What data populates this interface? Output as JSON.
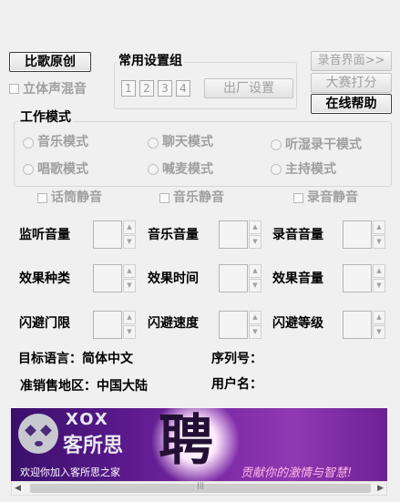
{
  "buttons": {
    "compare_original": "比歌原创",
    "recording_ui": "录音界面>>",
    "contest_score": "大赛打分",
    "online_help": "在线帮助",
    "factory_settings": "出厂设置"
  },
  "stereo_mix": "立体声混音",
  "preset_group": {
    "title": "常用设置组",
    "numbers": [
      "1",
      "2",
      "3",
      "4"
    ]
  },
  "work_mode": {
    "title": "工作模式",
    "options": [
      "音乐模式",
      "聊天模式",
      "听湿录干模式",
      "唱歌模式",
      "喊麦模式",
      "主持模式"
    ]
  },
  "mutes": {
    "mic": "话筒静音",
    "music": "音乐静音",
    "record": "录音静音"
  },
  "controls": {
    "monitor_volume": "监听音量",
    "music_volume": "音乐音量",
    "record_volume": "录音音量",
    "effect_type": "效果种类",
    "effect_time": "效果时间",
    "effect_volume": "效果音量",
    "flash_threshold": "闪避门限",
    "flash_speed": "闪避速度",
    "flash_level": "闪避等级"
  },
  "info": {
    "target_language": "目标语言：简体中文",
    "serial_no": "序列号：",
    "sales_region": "准销售地区：中国大陆",
    "username": "用户名："
  },
  "banner": {
    "logo_latin": "XOX",
    "logo_cn": "客所思",
    "big_char": "聘",
    "welcome": "欢迎你加入客所思之家",
    "slogan": "贡献你的激情与智慧!"
  },
  "colors": {
    "window_bg": "#f0f0f0",
    "banner_purple": "#6d2194",
    "disabled_text": "#a0a0a0"
  }
}
